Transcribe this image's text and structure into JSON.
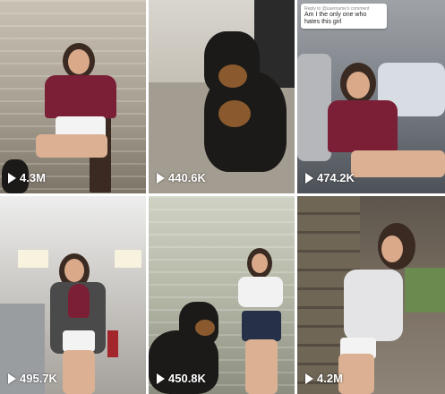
{
  "videos": [
    {
      "views": "4.3M"
    },
    {
      "views": "440.6K"
    },
    {
      "views": "474.2K",
      "caption_small": "Reply to @username's comment",
      "caption": "Am I the only one who hates this girl"
    },
    {
      "views": "495.7K"
    },
    {
      "views": "450.8K"
    },
    {
      "views": "4.2M"
    }
  ]
}
